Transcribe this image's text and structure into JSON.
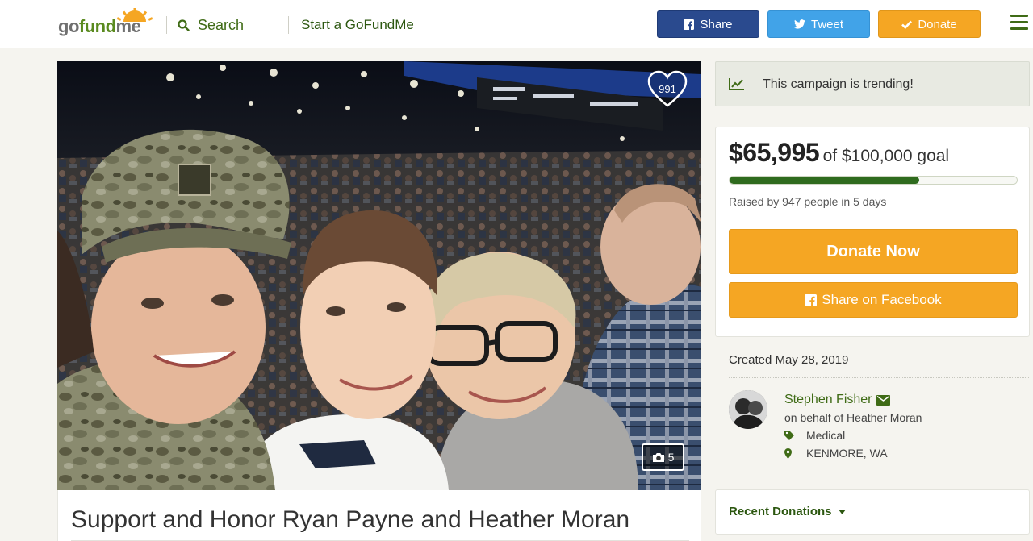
{
  "header": {
    "logo_part1": "go",
    "logo_part2": "fund",
    "logo_part3": "me",
    "search_label": "Search",
    "start_label": "Start a GoFundMe",
    "share_label": "Share",
    "tweet_label": "Tweet",
    "donate_label": "Donate"
  },
  "campaign": {
    "title": "Support and Honor Ryan Payne and Heather Moran",
    "heart_count": "991",
    "photo_count": "5",
    "trending_text": "This campaign is trending!",
    "raised_amount": "$65,995",
    "goal_text": "of $100,000 goal",
    "progress_fraction": 0.66,
    "raised_by": "Raised by 947 people in 5 days",
    "donate_now_label": "Donate Now",
    "share_facebook_label": "Share on Facebook",
    "created": "Created May 28, 2019",
    "organizer_name": "Stephen Fisher",
    "on_behalf": "on behalf of Heather Moran",
    "category": "Medical",
    "location": "KENMORE, WA",
    "recent_donations_label": "Recent Donations"
  },
  "colors": {
    "brand_green": "#3f6b16",
    "facebook_blue": "#2a4a8e",
    "twitter_blue": "#41a3e8",
    "donate_orange": "#f5a623",
    "progress_green": "#2f6b1e"
  },
  "icons": {
    "search": "search-icon",
    "facebook": "facebook-icon",
    "twitter": "twitter-icon",
    "check": "check-icon",
    "menu": "hamburger-menu-icon",
    "heart": "heart-icon",
    "camera": "camera-icon",
    "trending": "trending-chart-icon",
    "envelope": "envelope-icon",
    "tag": "tag-icon",
    "location": "map-marker-icon",
    "caret": "caret-down-icon"
  }
}
